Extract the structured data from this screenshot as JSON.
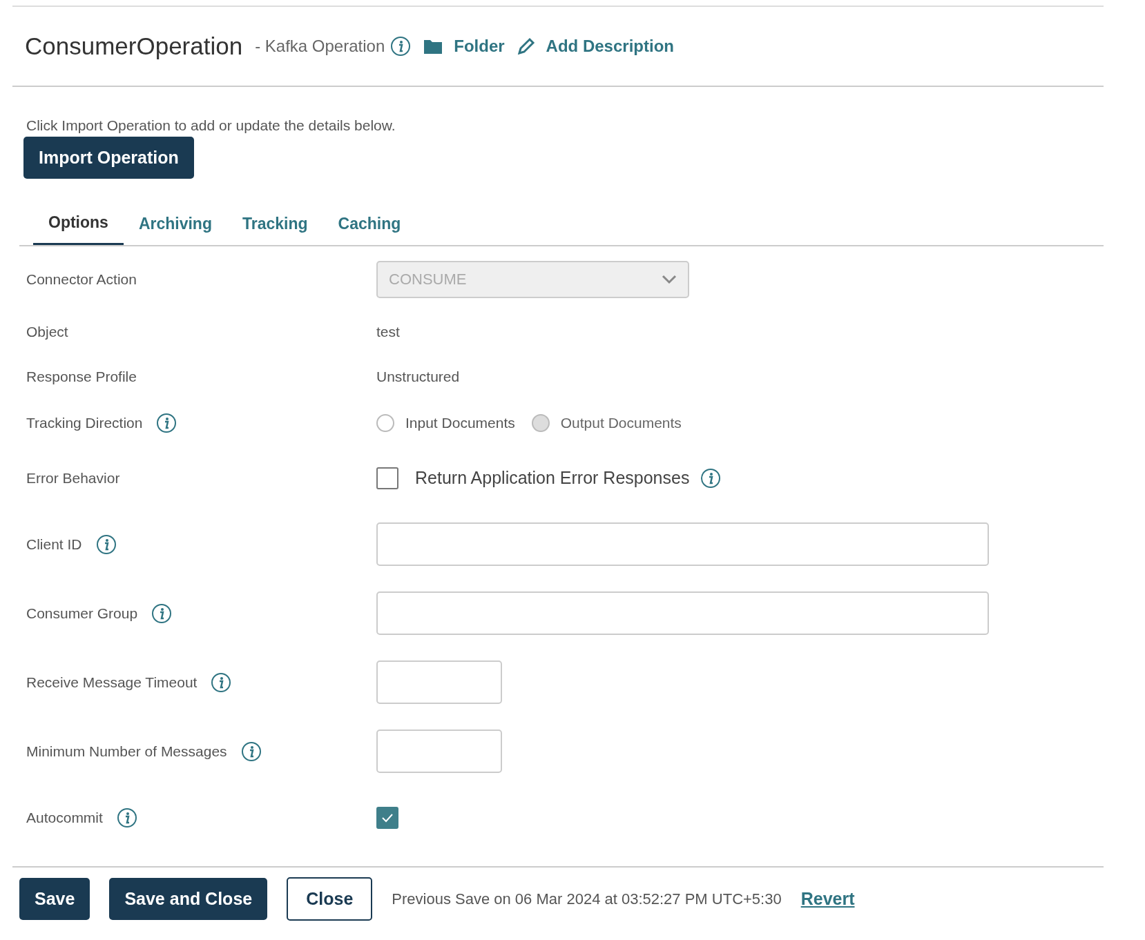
{
  "header": {
    "title": "ConsumerOperation",
    "subtitle": "- Kafka Operation",
    "links": [
      {
        "kind": "folder",
        "label": "Folder"
      },
      {
        "kind": "pencil",
        "label": "Add Description"
      }
    ]
  },
  "intro": "Click Import Operation to add or update the details below.",
  "import_button": "Import Operation",
  "tabs": [
    {
      "label": "Options",
      "selected": true
    },
    {
      "label": "Archiving",
      "selected": false
    },
    {
      "label": "Tracking",
      "selected": false
    },
    {
      "label": "Caching",
      "selected": false
    }
  ],
  "fields": [
    {
      "label": "Connector Action",
      "info": false,
      "kind": "select",
      "value": "CONSUME",
      "disabled": true
    },
    {
      "label": "Object",
      "info": false,
      "kind": "text",
      "value": "test"
    },
    {
      "label": "Response Profile",
      "info": false,
      "kind": "text",
      "value": "Unstructured"
    },
    {
      "label": "Tracking Direction",
      "info": true,
      "kind": "radio",
      "options": [
        {
          "label": "Input Documents",
          "selected": false,
          "disabled": false
        },
        {
          "label": "Output Documents",
          "selected": false,
          "disabled": true
        }
      ]
    },
    {
      "label": "Error Behavior",
      "info": false,
      "kind": "checkbox",
      "text": "Return Application Error Responses",
      "checked": false,
      "text_info": true
    },
    {
      "label": "Client ID",
      "info": true,
      "kind": "input"
    },
    {
      "label": "Consumer Group",
      "info": true,
      "kind": "input"
    },
    {
      "label": "Receive Message Timeout",
      "info": true,
      "kind": "short_input"
    },
    {
      "label": "Minimum Number of Messages",
      "info": true,
      "kind": "short_input"
    },
    {
      "label": "Autocommit",
      "info": true,
      "kind": "checkbox",
      "checked": true
    }
  ],
  "footer": {
    "buttons": [
      {
        "label": "Save",
        "kind": "primary"
      },
      {
        "label": "Save and Close",
        "kind": "primary"
      },
      {
        "label": "Close",
        "kind": "outline"
      }
    ],
    "status": "Previous Save on 06 Mar 2024 at 03:52:27 PM UTC+5:30",
    "revert": "Revert"
  }
}
